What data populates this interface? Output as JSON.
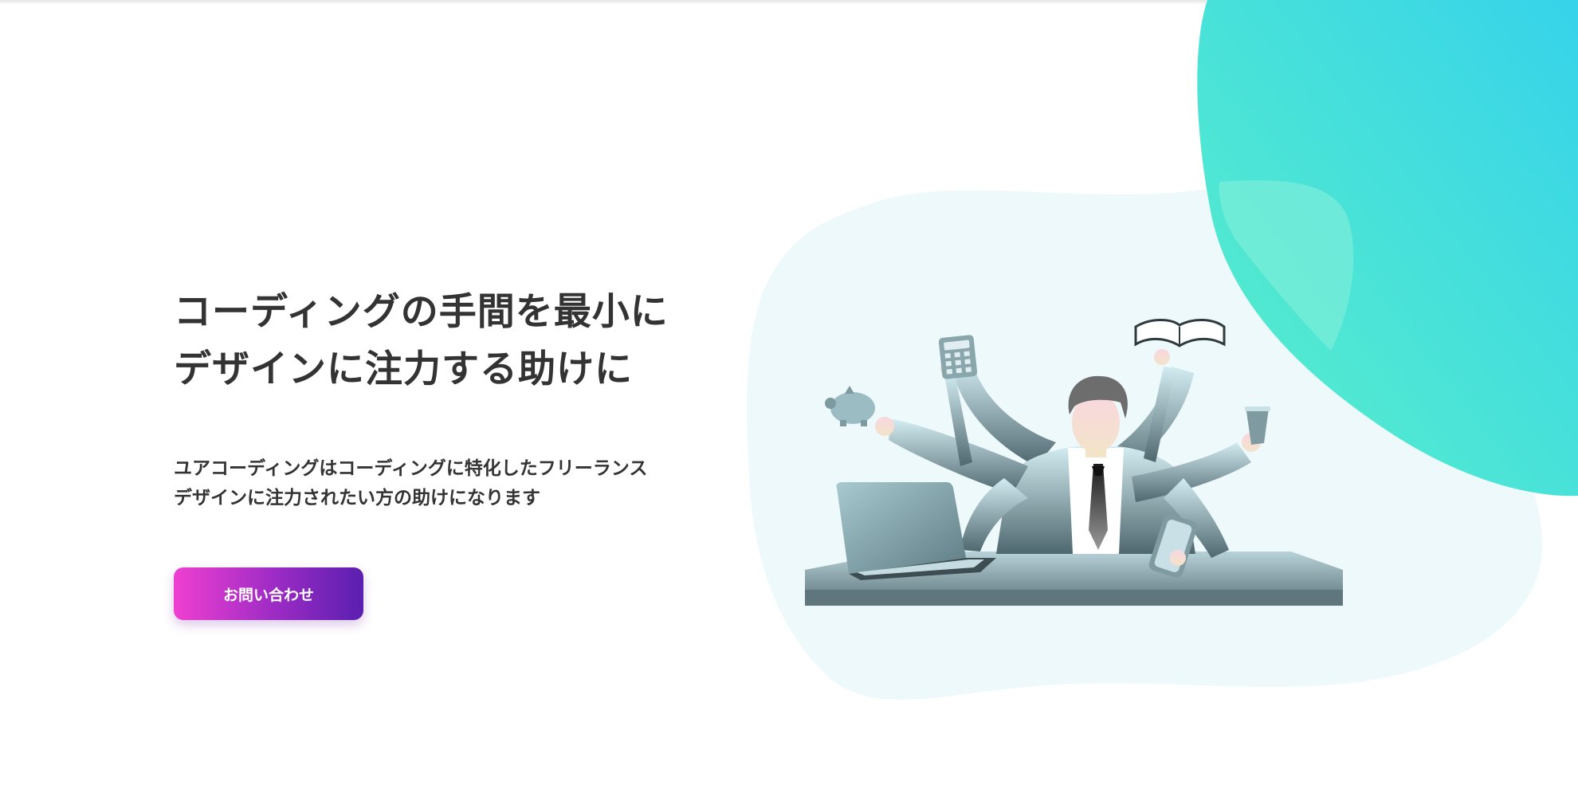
{
  "hero": {
    "headline_line1": "コーディングの手間を最小に",
    "headline_line2": "デザインに注力する助けに",
    "lead_line1": "ユアコーディングはコーディングに特化したフリーランス",
    "lead_line2": "デザインに注力されたい方の助けになります",
    "cta_label": "お問い合わせ"
  },
  "colors": {
    "text": "#333333",
    "cta_gradient_start": "#ef3fd0",
    "cta_gradient_end": "#5a1fb0",
    "blob_teal_start": "#5bf0c8",
    "blob_teal_end": "#36d3ea",
    "blob_pale": "#eef9fb"
  }
}
